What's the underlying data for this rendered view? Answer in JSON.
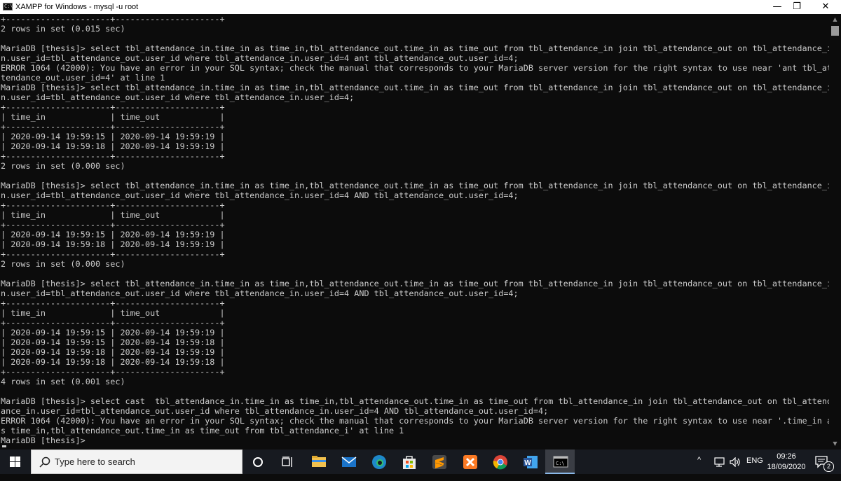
{
  "window": {
    "title": "XAMPP for Windows - mysql  -u root",
    "icon_text": "C:\\",
    "minimize_glyph": "—",
    "restore_glyph": "❐",
    "close_glyph": "✕"
  },
  "console": {
    "lines": [
      "+---------------------+---------------------+",
      "2 rows in set (0.015 sec)",
      "",
      "MariaDB [thesis]> select tbl_attendance_in.time_in as time_in,tbl_attendance_out.time_in as time_out from tbl_attendance_in join tbl_attendance_out on tbl_attendance_i",
      "n.user_id=tbl_attendance_out.user_id where tbl_attendance_in.user_id=4 ant tbl_attendance_out.user_id=4;",
      "ERROR 1064 (42000): You have an error in your SQL syntax; check the manual that corresponds to your MariaDB server version for the right syntax to use near 'ant tbl_at",
      "tendance_out.user_id=4' at line 1",
      "MariaDB [thesis]> select tbl_attendance_in.time_in as time_in,tbl_attendance_out.time_in as time_out from tbl_attendance_in join tbl_attendance_out on tbl_attendance_i",
      "n.user_id=tbl_attendance_out.user_id where tbl_attendance_in.user_id=4;",
      "+---------------------+---------------------+",
      "| time_in             | time_out            |",
      "+---------------------+---------------------+",
      "| 2020-09-14 19:59:15 | 2020-09-14 19:59:19 |",
      "| 2020-09-14 19:59:18 | 2020-09-14 19:59:19 |",
      "+---------------------+---------------------+",
      "2 rows in set (0.000 sec)",
      "",
      "MariaDB [thesis]> select tbl_attendance_in.time_in as time_in,tbl_attendance_out.time_in as time_out from tbl_attendance_in join tbl_attendance_out on tbl_attendance_i",
      "n.user_id=tbl_attendance_out.user_id where tbl_attendance_in.user_id=4 AND tbl_attendance_out.user_id=4;",
      "+---------------------+---------------------+",
      "| time_in             | time_out            |",
      "+---------------------+---------------------+",
      "| 2020-09-14 19:59:15 | 2020-09-14 19:59:19 |",
      "| 2020-09-14 19:59:18 | 2020-09-14 19:59:19 |",
      "+---------------------+---------------------+",
      "2 rows in set (0.000 sec)",
      "",
      "MariaDB [thesis]> select tbl_attendance_in.time_in as time_in,tbl_attendance_out.time_in as time_out from tbl_attendance_in join tbl_attendance_out on tbl_attendance_i",
      "n.user_id=tbl_attendance_out.user_id where tbl_attendance_in.user_id=4 AND tbl_attendance_out.user_id=4;",
      "+---------------------+---------------------+",
      "| time_in             | time_out            |",
      "+---------------------+---------------------+",
      "| 2020-09-14 19:59:15 | 2020-09-14 19:59:19 |",
      "| 2020-09-14 19:59:15 | 2020-09-14 19:59:18 |",
      "| 2020-09-14 19:59:18 | 2020-09-14 19:59:19 |",
      "| 2020-09-14 19:59:18 | 2020-09-14 19:59:18 |",
      "+---------------------+---------------------+",
      "4 rows in set (0.001 sec)",
      "",
      "MariaDB [thesis]> select cast  tbl_attendance_in.time_in as time_in,tbl_attendance_out.time_in as time_out from tbl_attendance_in join tbl_attendance_out on tbl_attend",
      "ance_in.user_id=tbl_attendance_out.user_id where tbl_attendance_in.user_id=4 AND tbl_attendance_out.user_id=4;",
      "ERROR 1064 (42000): You have an error in your SQL syntax; check the manual that corresponds to your MariaDB server version for the right syntax to use near '.time_in a",
      "s time_in,tbl_attendance_out.time_in as time_out from tbl_attendance_i' at line 1",
      "MariaDB [thesis]> "
    ]
  },
  "scrollbar": {
    "up_glyph": "▲",
    "down_glyph": "▼"
  },
  "taskbar": {
    "search_placeholder": "Type here to search",
    "apps": [
      {
        "name": "cortana-icon",
        "glyph": "○",
        "color": "#171a20"
      },
      {
        "name": "task-view-icon",
        "glyph": "⧉",
        "color": "#171a20"
      },
      {
        "name": "file-explorer-icon",
        "glyph": "",
        "color": "#f2c14e"
      },
      {
        "name": "mail-icon",
        "glyph": "✉",
        "color": "#1a73c8"
      },
      {
        "name": "edge-icon",
        "glyph": "e",
        "color": "#1e88c9"
      },
      {
        "name": "store-icon",
        "glyph": "🛍",
        "color": "#2b2f36"
      },
      {
        "name": "sublime-text-icon",
        "glyph": "S",
        "color": "#ff9800"
      },
      {
        "name": "xampp-icon",
        "glyph": "✕",
        "color": "#fb7a24"
      },
      {
        "name": "chrome-icon",
        "glyph": "◉",
        "color": "#db4437"
      },
      {
        "name": "word-icon",
        "glyph": "W",
        "color": "#2b579a"
      },
      {
        "name": "command-prompt-icon",
        "glyph": ">_",
        "color": "#000000"
      }
    ],
    "tray": {
      "chevron_glyph": "^",
      "network_glyph": "🖵",
      "volume_glyph": "🔊",
      "language": "ENG",
      "time": "09:26",
      "date": "18/09/2020",
      "notification_count": "2"
    }
  }
}
